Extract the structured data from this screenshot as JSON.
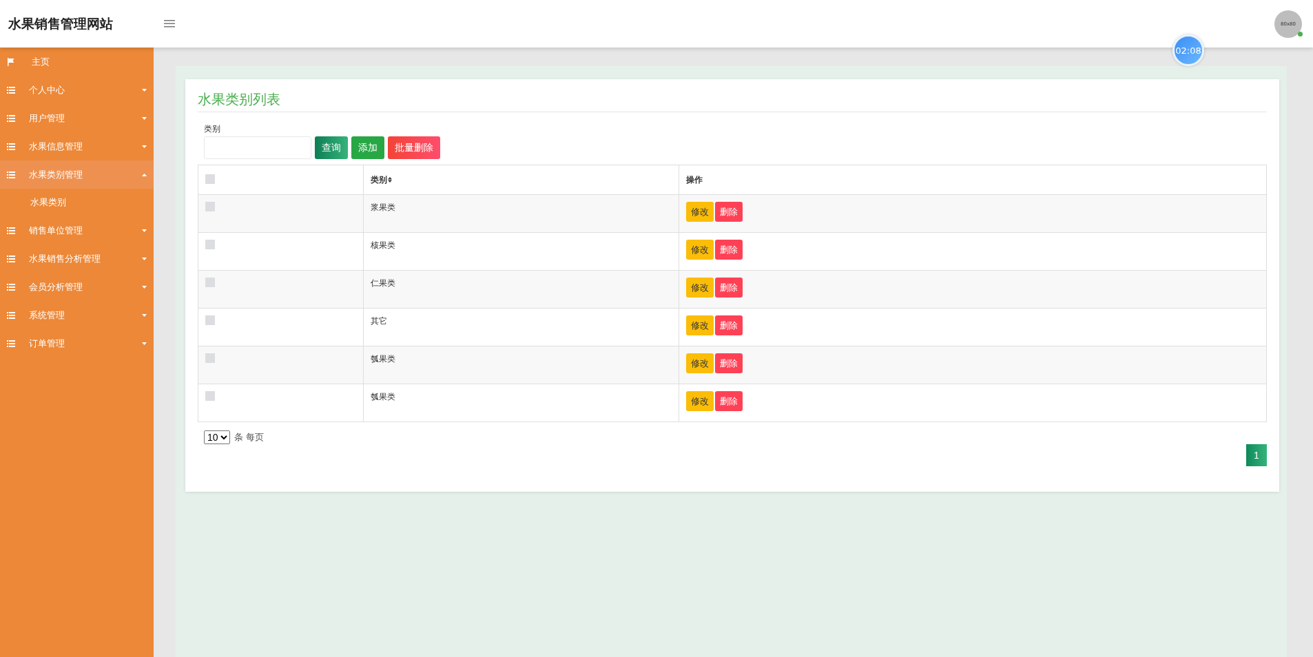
{
  "site_title": "水果销售管理网站",
  "sidebar": {
    "items": [
      {
        "kind": "home",
        "label": "主页",
        "expanded": false
      },
      {
        "kind": "menu",
        "label": "个人中心",
        "expanded": false
      },
      {
        "kind": "menu",
        "label": "用户管理",
        "expanded": false
      },
      {
        "kind": "menu",
        "label": "水果信息管理",
        "expanded": false
      },
      {
        "kind": "menu",
        "label": "水果类别管理",
        "expanded": true,
        "children": [
          {
            "label": "水果类别"
          }
        ]
      },
      {
        "kind": "menu",
        "label": "销售单位管理",
        "expanded": false
      },
      {
        "kind": "menu",
        "label": "水果销售分析管理",
        "expanded": false
      },
      {
        "kind": "menu",
        "label": "会员分析管理",
        "expanded": false
      },
      {
        "kind": "menu",
        "label": "系统管理",
        "expanded": false
      },
      {
        "kind": "menu",
        "label": "订单管理",
        "expanded": false
      }
    ]
  },
  "avatar": {
    "label": "80x80"
  },
  "timer": "02:08",
  "page_title": "水果类别列表",
  "search": {
    "label": "类别"
  },
  "buttons": [
    {
      "kind": "query",
      "label": "查询"
    },
    {
      "kind": "add",
      "label": "添加"
    },
    {
      "kind": "delete",
      "label": "批量删除"
    }
  ],
  "table": {
    "header_checked": false,
    "columns": [
      "类别",
      "操作"
    ],
    "rows": [
      {
        "checked": false,
        "category": "浆果类",
        "actions": [
          "修改",
          "删除"
        ]
      },
      {
        "checked": false,
        "category": "核果类",
        "actions": [
          "修改",
          "删除"
        ]
      },
      {
        "checked": false,
        "category": "仁果类",
        "actions": [
          "修改",
          "删除"
        ]
      },
      {
        "checked": false,
        "category": "其它",
        "actions": [
          "修改",
          "删除"
        ]
      },
      {
        "checked": false,
        "category": "瓠果类",
        "actions": [
          "修改",
          "删除"
        ]
      },
      {
        "checked": false,
        "category": "瓠果类",
        "actions": [
          "修改",
          "删除"
        ]
      }
    ]
  },
  "page_size": {
    "value": "10",
    "suffix": "条 每页"
  },
  "pagination": [
    {
      "label": "1",
      "selected": true
    }
  ]
}
